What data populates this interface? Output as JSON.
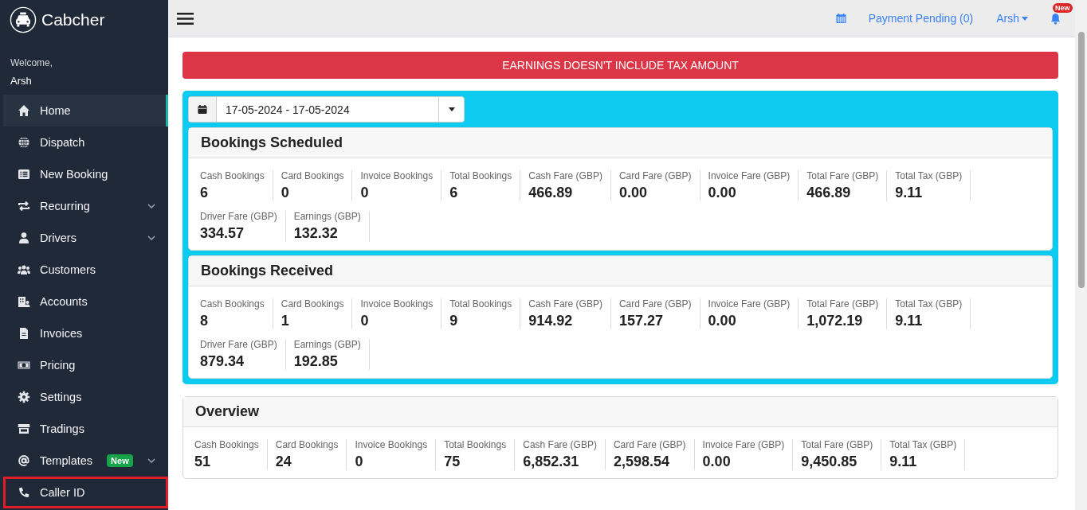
{
  "brand": {
    "name": "Cabcher"
  },
  "welcome": {
    "greeting": "Welcome,",
    "user": "Arsh"
  },
  "sidebar": {
    "items": [
      {
        "label": "Home",
        "selected": true,
        "expandable": false,
        "highlighted": false
      },
      {
        "label": "Dispatch",
        "selected": false,
        "expandable": false,
        "highlighted": false
      },
      {
        "label": "New Booking",
        "selected": false,
        "expandable": false,
        "highlighted": false
      },
      {
        "label": "Recurring",
        "selected": false,
        "expandable": true,
        "highlighted": false
      },
      {
        "label": "Drivers",
        "selected": false,
        "expandable": true,
        "highlighted": false
      },
      {
        "label": "Customers",
        "selected": false,
        "expandable": false,
        "highlighted": false
      },
      {
        "label": "Accounts",
        "selected": false,
        "expandable": false,
        "highlighted": false
      },
      {
        "label": "Invoices",
        "selected": false,
        "expandable": false,
        "highlighted": false
      },
      {
        "label": "Pricing",
        "selected": false,
        "expandable": false,
        "highlighted": false
      },
      {
        "label": "Settings",
        "selected": false,
        "expandable": false,
        "highlighted": false
      },
      {
        "label": "Tradings",
        "selected": false,
        "expandable": false,
        "highlighted": false
      },
      {
        "label": "Templates",
        "selected": false,
        "expandable": true,
        "highlighted": false,
        "badge": "New"
      },
      {
        "label": "Caller ID",
        "selected": false,
        "expandable": false,
        "highlighted": true
      }
    ]
  },
  "topbar": {
    "payment_link": "Payment Pending (0)",
    "user_menu": "Arsh",
    "notification_badge": "New"
  },
  "alert": "EARNINGS DOESN'T INCLUDE TAX AMOUNT",
  "date_range": {
    "value": "17-05-2024 - 17-05-2024"
  },
  "panels": [
    {
      "title": "Bookings Scheduled",
      "in_filter_panel": true,
      "rows": [
        [
          {
            "label": "Cash Bookings",
            "value": "6"
          },
          {
            "label": "Card Bookings",
            "value": "0"
          },
          {
            "label": "Invoice Bookings",
            "value": "0"
          },
          {
            "label": "Total Bookings",
            "value": "6"
          },
          {
            "label": "Cash Fare (GBP)",
            "value": "466.89"
          },
          {
            "label": "Card Fare (GBP)",
            "value": "0.00"
          },
          {
            "label": "Invoice Fare (GBP)",
            "value": "0.00"
          },
          {
            "label": "Total Fare (GBP)",
            "value": "466.89"
          },
          {
            "label": "Total Tax (GBP)",
            "value": "9.11"
          }
        ],
        [
          {
            "label": "Driver Fare (GBP)",
            "value": "334.57"
          },
          {
            "label": "Earnings (GBP)",
            "value": "132.32"
          }
        ]
      ]
    },
    {
      "title": "Bookings Received",
      "in_filter_panel": true,
      "rows": [
        [
          {
            "label": "Cash Bookings",
            "value": "8"
          },
          {
            "label": "Card Bookings",
            "value": "1"
          },
          {
            "label": "Invoice Bookings",
            "value": "0"
          },
          {
            "label": "Total Bookings",
            "value": "9"
          },
          {
            "label": "Cash Fare (GBP)",
            "value": "914.92"
          },
          {
            "label": "Card Fare (GBP)",
            "value": "157.27"
          },
          {
            "label": "Invoice Fare (GBP)",
            "value": "0.00"
          },
          {
            "label": "Total Fare (GBP)",
            "value": "1,072.19"
          },
          {
            "label": "Total Tax (GBP)",
            "value": "9.11"
          }
        ],
        [
          {
            "label": "Driver Fare (GBP)",
            "value": "879.34"
          },
          {
            "label": "Earnings (GBP)",
            "value": "192.85"
          }
        ]
      ]
    },
    {
      "title": "Overview",
      "in_filter_panel": false,
      "rows": [
        [
          {
            "label": "Cash Bookings",
            "value": "51"
          },
          {
            "label": "Card Bookings",
            "value": "24"
          },
          {
            "label": "Invoice Bookings",
            "value": "0"
          },
          {
            "label": "Total Bookings",
            "value": "75"
          },
          {
            "label": "Cash Fare (GBP)",
            "value": "6,852.31"
          },
          {
            "label": "Card Fare (GBP)",
            "value": "2,598.54"
          },
          {
            "label": "Invoice Fare (GBP)",
            "value": "0.00"
          },
          {
            "label": "Total Fare (GBP)",
            "value": "9,450.85"
          },
          {
            "label": "Total Tax (GBP)",
            "value": "9.11"
          }
        ]
      ]
    }
  ]
}
